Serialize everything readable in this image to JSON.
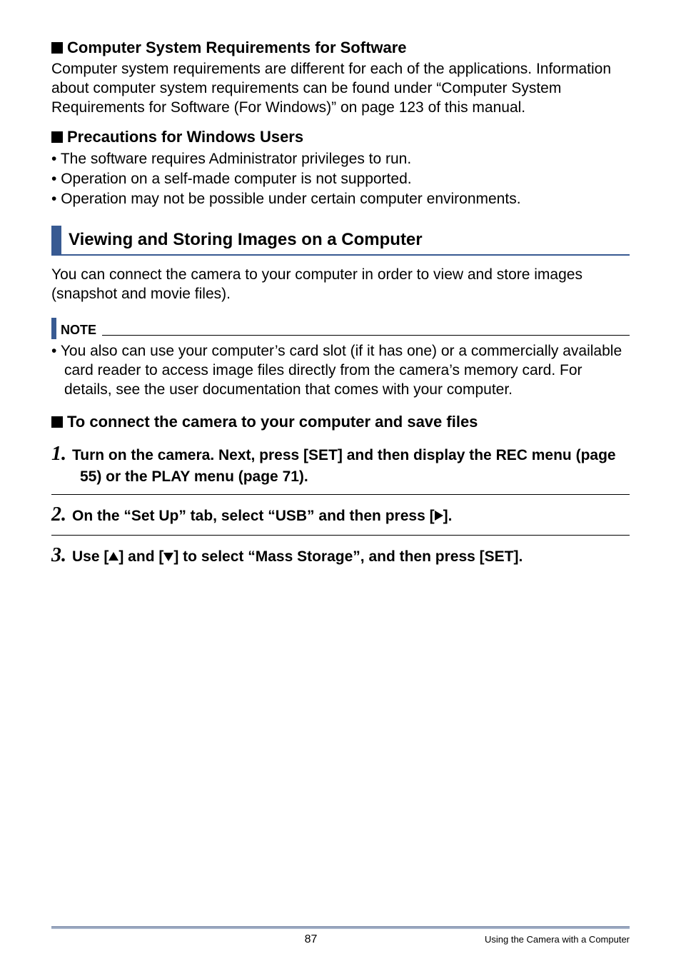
{
  "s1": {
    "title": "Computer System Requirements for Software",
    "body": "Computer system requirements are different for each of the applications. Information about computer system requirements can be found under “Computer System Requirements for Software (For Windows)” on page 123 of this manual."
  },
  "s2": {
    "title": "Precautions for Windows Users",
    "b1": "The software requires Administrator privileges to run.",
    "b2": "Operation on a self-made computer is not supported.",
    "b3": "Operation may not be possible under certain computer environments."
  },
  "bar": {
    "title": "Viewing and Storing Images on a Computer"
  },
  "intro": "You can connect the camera to your computer in order to view and store images (snapshot and movie files).",
  "note": {
    "label": "NOTE",
    "b1": "You also can use your computer’s card slot (if it has one) or a commercially available card reader to access image files directly from the camera’s memory card. For details, see the user documentation that comes with your computer."
  },
  "s3": {
    "title": "To connect the camera to your computer and save files"
  },
  "steps": {
    "n1": "1.",
    "t1": "Turn on the camera. Next, press [SET] and then display the REC menu (page 55) or the PLAY menu (page 71).",
    "n2": "2.",
    "t2a": "On the “Set Up” tab, select “USB” and then press [",
    "t2b": "].",
    "n3": "3.",
    "t3a": "Use [",
    "t3b": "] and [",
    "t3c": "] to select “Mass Storage”, and then press [SET]."
  },
  "footer": {
    "page": "87",
    "section": "Using the Camera with a Computer"
  }
}
